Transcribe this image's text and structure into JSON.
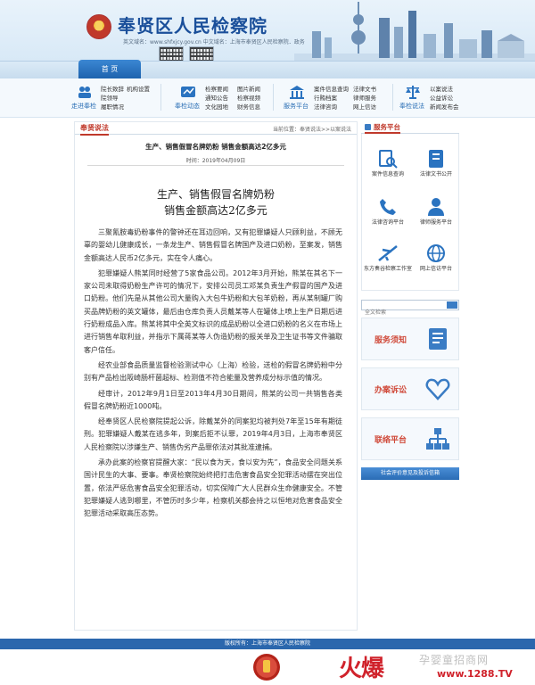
{
  "header": {
    "site_title": "奉贤区人民检察院",
    "subline": "英文域名：www.shfxjcy.gov.cn   中文域名：上海市奉贤区人民检察院．政务",
    "home_tab": "首 页"
  },
  "quicklinks": {
    "groups": [
      {
        "caption": "走进奉检",
        "links": [
          "院长致辞",
          "院领导",
          "机构设置",
          "履职情况"
        ]
      },
      {
        "caption": "奉检动态",
        "links": [
          "检察要闻",
          "通知公告",
          "文化园地",
          "图片新闻",
          "检察视频",
          "财务信息"
        ]
      },
      {
        "caption": "服务平台",
        "links": [
          "案件信息查询",
          "行贿档案",
          "法律咨询",
          "法律文书",
          "律师服务",
          "网上信访"
        ]
      },
      {
        "caption": "奉检说法",
        "links": [
          "以案说法",
          "公益诉讼",
          "新闻发布会"
        ]
      }
    ]
  },
  "main": {
    "tab_label": "奉贤说法",
    "breadcrumb": "当前位置：奉贤说法>>以案说法",
    "article_title": "生产、销售假冒名牌奶粉 销售金额高达2亿多元",
    "time": "时间：2019年04月09日",
    "headline_1": "生产、销售假冒名牌奶粉",
    "headline_2": "销售金额高达2亿多元",
    "paragraphs": [
      "三聚氰胺毒奶粉事件的警钟还在耳边回响，又有犯罪嫌疑人只顾利益，不顾无辜的婴幼儿健康成长，一条龙生产、销售假冒名牌国产及进口奶粉，至案发，销售金额高达人民币2亿多元，实在令人痛心。",
      "犯罪嫌疑人熊某同时经营了5家食品公司。2012年3月开始，熊某在其名下一家公司未取得奶粉生产许可的情况下，安排公司员工邓某负责生产假冒的国产及进口奶粉。他们先是从其他公司大量购入大包牛奶粉和大包羊奶粉，再从某制罐厂购买品牌奶粉的英文罐体，最后由仓库负责人员戴某等人在罐体上喷上生产日期后进行奶粉成品入库。熊某将其中全英文标识的成品奶粉以全进口奶粉的名义在市场上进行销售牟取利益，并指示下属蒋某等人伪造奶粉的报关单及卫生证书等文件骗取客户信任。",
      "经农业部食品质量监督检验测试中心（上海）检验，送检的假冒名牌奶粉中分别有产品检出阪崎肠杆菌超标、检测值不符合能量及营养成分标示值的情况。",
      "经审计，2012年9月1日至2013年4月30日期间，熊某的公司一共销售各类假冒名牌奶粉近1000吨。",
      "经奉贤区人民检察院提起公诉，除戴某外的同案犯均被判处7年至15年有期徒刑。犯罪嫌疑人戴某在逃多年，到案后拒不认罪，2019年4月3日，上海市奉贤区人民检察院以涉嫌生产、销售伪劣产品罪依法对其批准逮捕。",
      "承办此案的检察官提醒大家：“民以食为天，食以安为先”，食品安全问题关系国计民生的大事、要事。奉贤检察院始终把打击危害食品安全犯罪活动摆在突出位置，依法严惩危害食品安全犯罪活动，切实保障广大人民群众生命健康安全。不管犯罪嫌疑人逃到哪里，不管历时多少年，检察机关都会持之以恒地对危害食品安全犯罪活动采取高压态势。"
    ]
  },
  "sidebar": {
    "panel_title": "服务平台",
    "services": [
      {
        "label": "案件信息查询",
        "icon": "document-search-icon"
      },
      {
        "label": "法律文书公开",
        "icon": "book-icon"
      },
      {
        "label": "法律咨询平台",
        "icon": "phone-icon"
      },
      {
        "label": "律师服务平台",
        "icon": "lawyer-icon"
      },
      {
        "label": "东方奏谷检察工作室",
        "icon": "plane-icon"
      },
      {
        "label": "网上信访平台",
        "icon": "globe-icon"
      }
    ],
    "search_placeholder": "全文检索",
    "cards": [
      {
        "label": "服务须知",
        "color": "#d04a3a"
      },
      {
        "label": "办案诉讼",
        "color": "#d04a3a"
      },
      {
        "label": "联络平台",
        "color": "#d04a3a"
      }
    ],
    "feedback_label": "社会评价意见及投诉信箱"
  },
  "footer": {
    "copyright": "版权所有：上海市奉贤区人民检察院"
  },
  "watermark": {
    "logo_text": "火爆",
    "line1": "孕婴童招商网",
    "line2": "www.1288.TV"
  }
}
